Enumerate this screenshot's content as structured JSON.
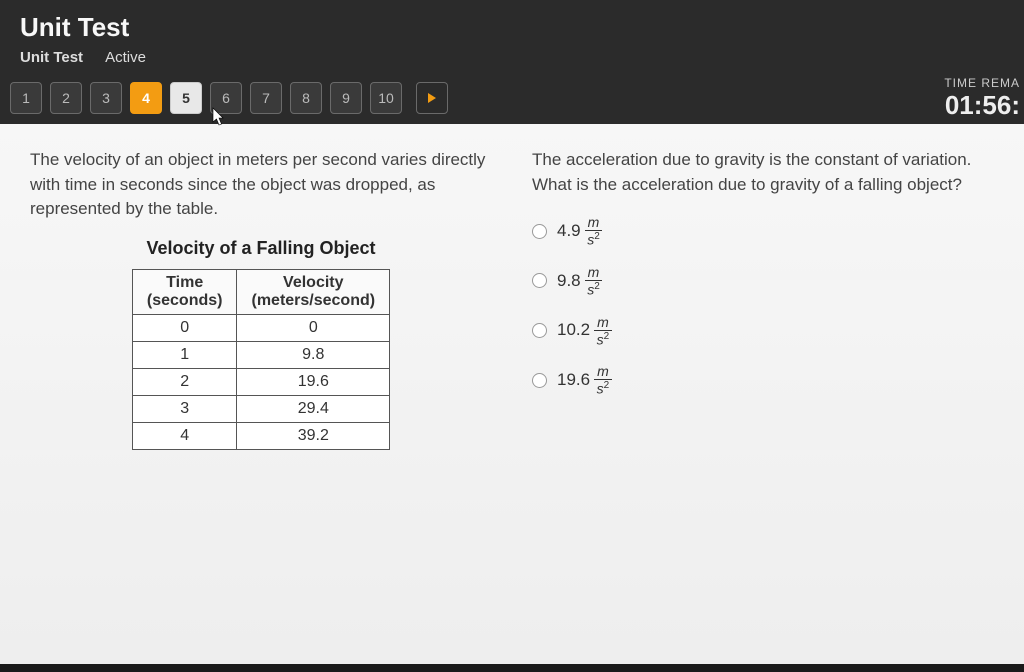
{
  "header": {
    "title": "Unit Test",
    "breadcrumb": "Unit Test",
    "status": "Active"
  },
  "nav": {
    "items": [
      "1",
      "2",
      "3",
      "4",
      "5",
      "6",
      "7",
      "8",
      "9",
      "10"
    ],
    "current_index": 3,
    "hover_index": 4,
    "timer_label": "TIME REMA",
    "timer_value": "01:56:"
  },
  "question": {
    "left_prompt": "The velocity of an object in meters per second varies directly with time in seconds since the object was dropped, as represented by the table.",
    "right_prompt": "The acceleration due to gravity is the constant of variation. What is the acceleration due to gravity of a falling object?",
    "table_title": "Velocity of a Falling Object",
    "table": {
      "col1_header_top": "Time",
      "col1_header_bottom": "(seconds)",
      "col2_header_top": "Velocity",
      "col2_header_bottom": "(meters/second)",
      "rows": [
        {
          "t": "0",
          "v": "0"
        },
        {
          "t": "1",
          "v": "9.8"
        },
        {
          "t": "2",
          "v": "19.6"
        },
        {
          "t": "3",
          "v": "29.4"
        },
        {
          "t": "4",
          "v": "39.2"
        }
      ]
    },
    "options": [
      {
        "value": "4.9"
      },
      {
        "value": "9.8"
      },
      {
        "value": "10.2"
      },
      {
        "value": "19.6"
      }
    ],
    "unit_numerator": "m",
    "unit_denominator_base": "s",
    "unit_denominator_exp": "2"
  },
  "chart_data": {
    "type": "table",
    "title": "Velocity of a Falling Object",
    "columns": [
      "Time (seconds)",
      "Velocity (meters/second)"
    ],
    "rows": [
      [
        0,
        0
      ],
      [
        1,
        9.8
      ],
      [
        2,
        19.6
      ],
      [
        3,
        29.4
      ],
      [
        4,
        39.2
      ]
    ]
  }
}
